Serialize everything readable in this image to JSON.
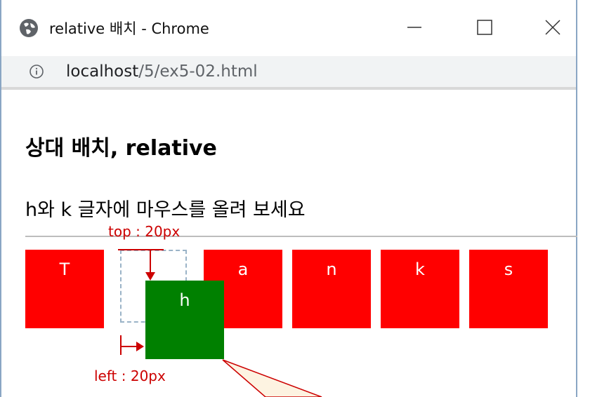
{
  "window": {
    "title": "relative 배치 - Chrome",
    "url_host": "localhost",
    "url_path": "/5/ex5-02.html"
  },
  "page": {
    "heading": "상대 배치, relative",
    "subtitle": "h와 k 글자에 마우스를 올려 보세요",
    "boxes": [
      "T",
      "h",
      "a",
      "n",
      "k",
      "s"
    ]
  },
  "annotations": {
    "top_label": "top : 20px",
    "left_label": "left : 20px"
  },
  "colors": {
    "box_default": "#ff0000",
    "box_hover": "#008000",
    "annotation": "#cc0000"
  }
}
